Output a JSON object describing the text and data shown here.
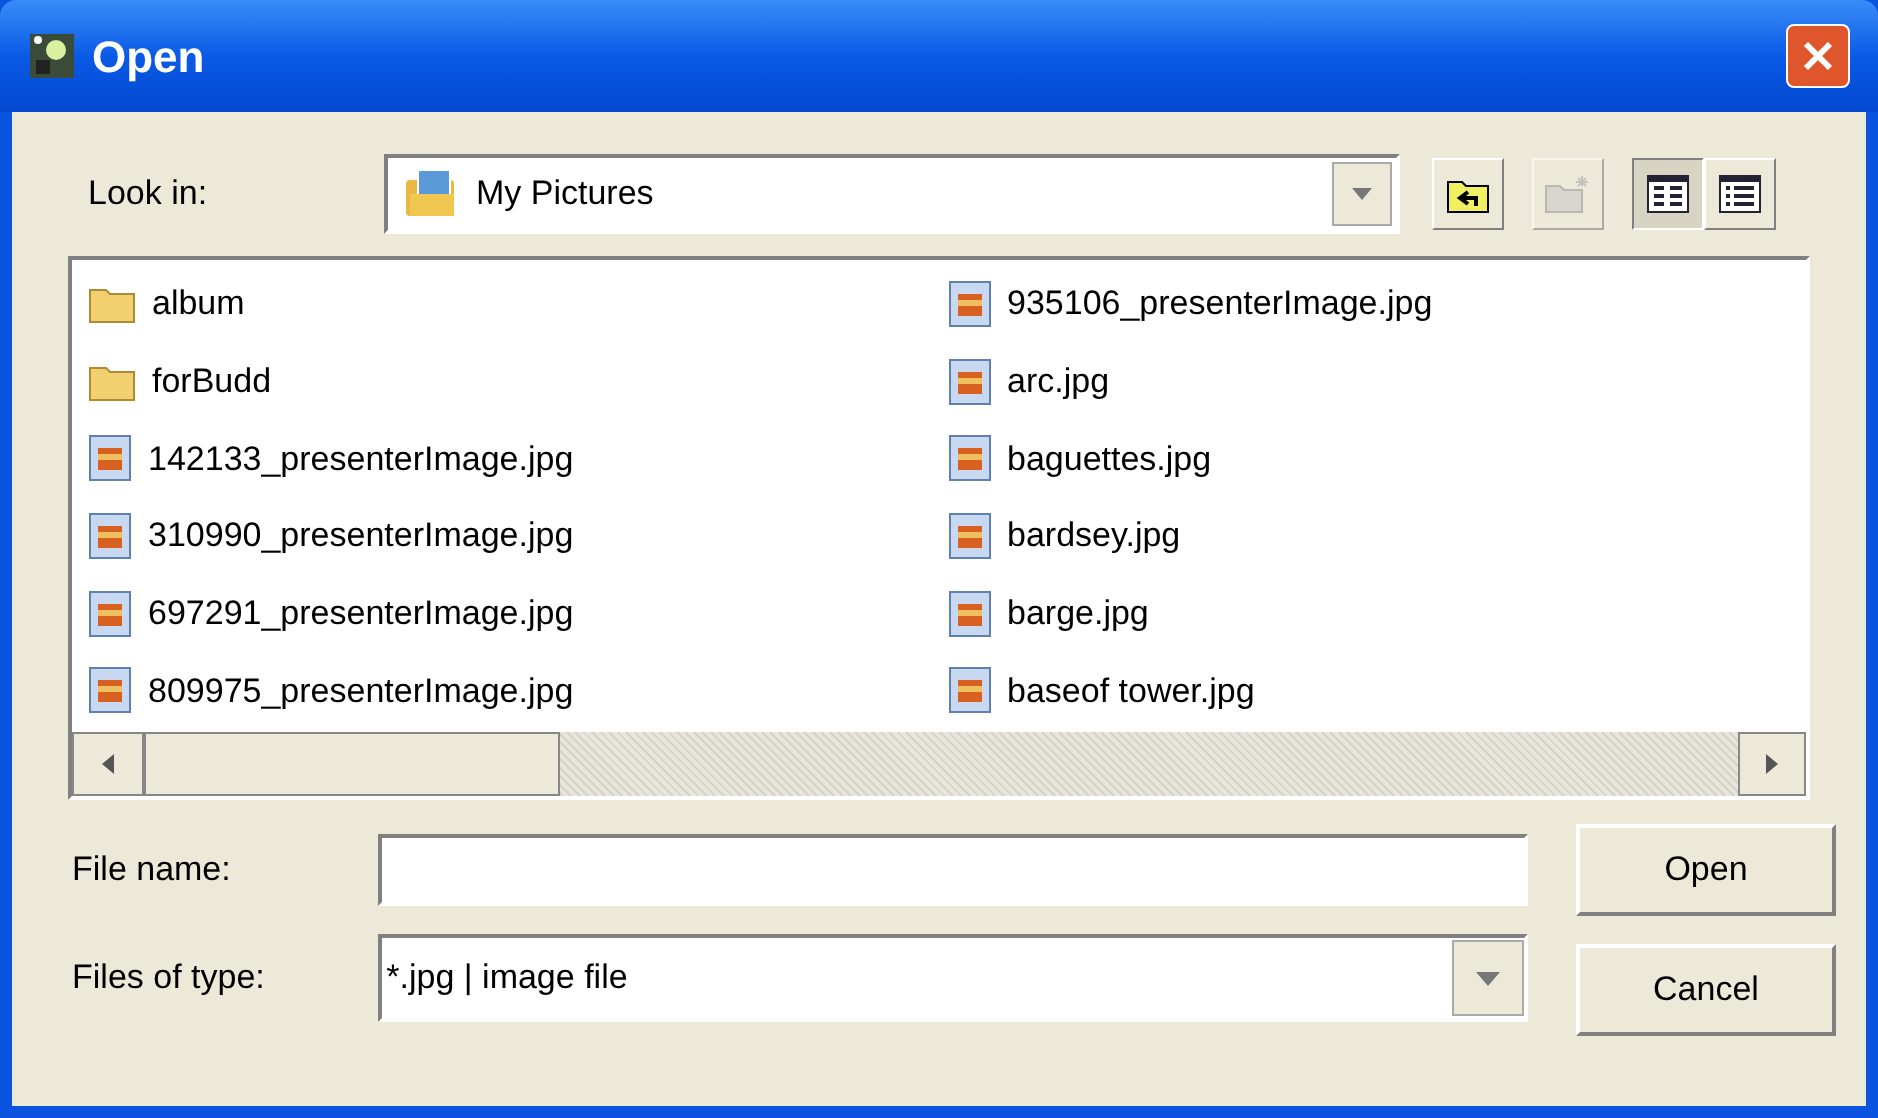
{
  "window": {
    "title": "Open"
  },
  "look_in": {
    "label": "Look in:",
    "value": "My Pictures"
  },
  "toolbar": [
    {
      "kind": "up",
      "disabled": false,
      "selected": false
    },
    {
      "kind": "newfolder",
      "disabled": true,
      "selected": false
    },
    {
      "kind": "list",
      "disabled": false,
      "selected": true
    },
    {
      "kind": "details",
      "disabled": false,
      "selected": false
    }
  ],
  "files": [
    {
      "kind": "folder",
      "name": "album"
    },
    {
      "kind": "folder",
      "name": "forBudd"
    },
    {
      "kind": "image",
      "name": "142133_presenterImage.jpg"
    },
    {
      "kind": "image",
      "name": "310990_presenterImage.jpg"
    },
    {
      "kind": "image",
      "name": "697291_presenterImage.jpg"
    },
    {
      "kind": "image",
      "name": "809975_presenterImage.jpg"
    },
    {
      "kind": "image",
      "name": "935106_presenterImage.jpg"
    },
    {
      "kind": "image",
      "name": "arc.jpg"
    },
    {
      "kind": "image",
      "name": "baguettes.jpg"
    },
    {
      "kind": "image",
      "name": "bardsey.jpg"
    },
    {
      "kind": "image",
      "name": "barge.jpg"
    },
    {
      "kind": "image",
      "name": "baseof tower.jpg"
    }
  ],
  "file_name": {
    "label": "File name:"
  },
  "file_type": {
    "label": "Files of type:",
    "value": "*.jpg | image file"
  },
  "buttons": [
    "Open",
    "Cancel"
  ]
}
